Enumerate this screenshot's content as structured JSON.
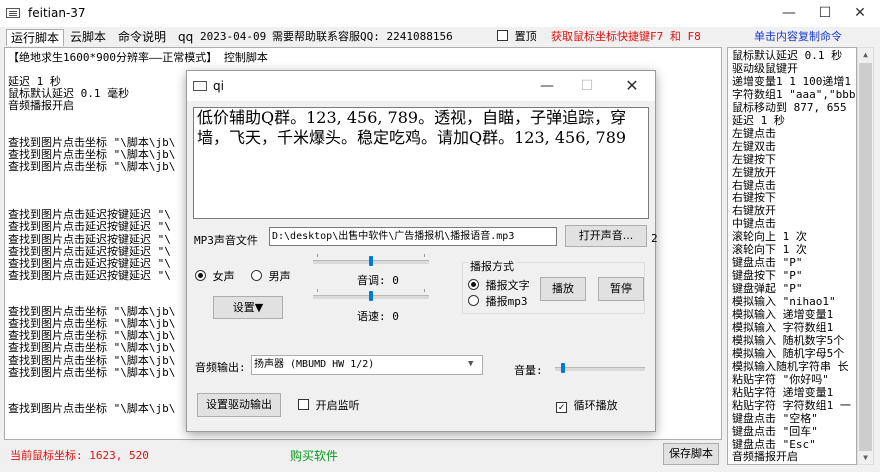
{
  "window": {
    "title": "feitian-37",
    "minimize": "—",
    "maximize": "☐",
    "close": "✕"
  },
  "menubar": {
    "tabs": [
      "运行脚本",
      "云脚本",
      "命令说明",
      "qq"
    ],
    "date": "2023-04-09",
    "help_text": "需要帮助联系容服QQ: 2241088156",
    "top_checkbox_label": "置顶",
    "hotkey_hint": "获取鼠标坐标快捷键F7 和 F8",
    "copy_hint": "单击内容复制命令"
  },
  "log": {
    "lines": [
      "【绝地求生1600*900分辨率——正常模式】    控制脚本",
      "",
      "延迟 1 秒",
      "鼠标默认延迟 0.1 毫秒",
      "音频播报开启",
      "",
      "",
      "查找到图片点击坐标 \"\\脚本\\jb\\",
      "查找到图片点击坐标 \"\\脚本\\jb\\",
      "查找到图片点击坐标 \"\\脚本\\jb\\",
      "",
      "",
      "",
      "查找到图片点击延迟按键延迟 \"\\",
      "查找到图片点击延迟按键延迟 \"\\",
      "查找到图片点击延迟按键延迟 \"\\",
      "查找到图片点击延迟按键延迟 \"\\",
      "查找到图片点击延迟按键延迟 \"\\",
      "查找到图片点击延迟按键延迟 \"\\",
      "",
      "",
      "查找到图片点击坐标 \"\\脚本\\jb\\",
      "查找到图片点击坐标 \"\\脚本\\jb\\",
      "查找到图片点击坐标 \"\\脚本\\jb\\",
      "查找到图片点击坐标 \"\\脚本\\jb\\",
      "查找到图片点击坐标 \"\\脚本\\jb\\",
      "查找到图片点击坐标 \"\\脚本\\jb\\",
      "",
      "",
      "查找到图片点击坐标 \"\\脚本\\jb\\"
    ]
  },
  "commands": [
    "鼠标默认延迟 0.1 秒",
    "驱动级鼠键开",
    "递增变量1 1 100递增1",
    "字符数组1 \"aaa\",\"bbb\"",
    "鼠标移动到 877, 655",
    "延迟 1 秒",
    "左键点击",
    "左键双击",
    "左键按下",
    "左键放开",
    "右键点击",
    "右键按下",
    "右键放开",
    "中键点击",
    "滚轮向上 1 次",
    "滚轮向下 1 次",
    "键盘点击 \"P\"",
    "键盘按下 \"P\"",
    "键盘弹起 \"P\"",
    "模拟输入 \"nihao1\"",
    "模拟输入 递增变量1",
    "模拟输入 字符数组1",
    "模拟输入 随机数字5个",
    "模拟输入 随机字母5个",
    "模拟输入随机字符串 长",
    "粘贴字符 \"你好吗\"",
    "粘贴字符 递增变量1",
    "粘贴字符 字符数组1 一",
    "键盘点击 \"空格\"",
    "键盘点击 \"回车\"",
    "键盘点击 \"Esc\"",
    "音频播报开启"
  ],
  "status": {
    "coords": "当前鼠标坐标: 1623, 520",
    "buy": "购买软件",
    "save": "保存脚本"
  },
  "dialog": {
    "title": "qi",
    "minimize": "—",
    "maximize": "☐",
    "close": "✕",
    "text": "低价辅助Q群。123, 456, 789。透视，自瞄，子弹追踪，穿墙，飞天，千米爆头。稳定吃鸡。请加Q群。123, 456, 789",
    "mp3_label": "MP3声音文件",
    "mp3_path": "D:\\desktop\\出售中软件\\广告播报机\\播报语音.mp3",
    "open_button": "打开声音...",
    "peek_text": "2",
    "voice_female": "女声",
    "voice_male": "男声",
    "pitch_label": "音调: 0",
    "speed_label": "语速: 0",
    "settings_button": "设置▼",
    "broadcast_mode_label": "播报方式",
    "mode_text": "播报文字",
    "mode_mp3": "播报mp3",
    "play_button": "播放",
    "pause_button": "暂停",
    "output_label": "音频输出:",
    "output_value": "扬声器 (MBUMD HW 1/2)",
    "volume_label": "音量:",
    "setup_driver_button": "设置驱动输出",
    "monitor_label": "开启监听",
    "loop_label": "循环播放",
    "pitch_level": 0.5,
    "speed_level": 0.5,
    "volume_level": 0.05
  },
  "colors": {
    "accent": "#0078d7",
    "red": "#e01010",
    "blue": "#1a3ccc",
    "green": "#0a9a20"
  }
}
